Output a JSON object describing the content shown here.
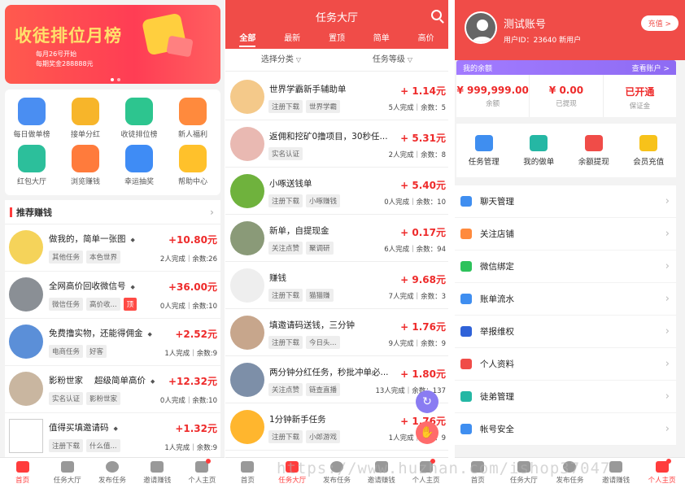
{
  "panel1": {
    "banner": {
      "title": "收徒排位月榜",
      "line1": "每月26号开始",
      "line2": "每期奖金288888元"
    },
    "icons": [
      {
        "label": "每日做单榜",
        "icon": "list-icon",
        "color": "#4a8ef2"
      },
      {
        "label": "接单分红",
        "icon": "yen-icon",
        "color": "#f7b52a"
      },
      {
        "label": "收徒排位榜",
        "icon": "bar-chart-icon",
        "color": "#2dc58f"
      },
      {
        "label": "新人福利",
        "icon": "gift-icon",
        "color": "#ff8a3d"
      },
      {
        "label": "红包大厅",
        "icon": "red-envelope-icon",
        "color": "#2cbf9b"
      },
      {
        "label": "浏览赚钱",
        "icon": "money-bag-icon",
        "color": "#ff7b3c"
      },
      {
        "label": "幸运抽奖",
        "icon": "wheel-icon",
        "color": "#3f8cf5"
      },
      {
        "label": "帮助中心",
        "icon": "bulb-icon",
        "color": "#ffc12b"
      }
    ],
    "recommend_title": "推荐赚钱",
    "items": [
      {
        "title": "做我的，简单一张图",
        "platforms": " ",
        "price": "+10.80元",
        "tags": [
          "其他任务",
          "本色世界"
        ],
        "stat": "2人完成｜余数:26",
        "color": "#f5d35a"
      },
      {
        "title": "全网高价回收微信号",
        "platforms": " ",
        "price": "+36.00元",
        "tags": [
          "微信任务",
          "高价收...",
          "顶"
        ],
        "stat": "0人完成｜余数:10",
        "color": "#8a8f95"
      },
      {
        "title": "免费撸实物，还能得佣金",
        "platforms": " ",
        "price": "+2.52元",
        "tags": [
          "电商任务",
          "好客"
        ],
        "stat": "1人完成｜余数:9",
        "color": "#5b8fd8"
      },
      {
        "title": "影粉世家",
        "platforms": " ",
        "price": "+12.32元",
        "tags": [
          "实名认证",
          "影粉世家"
        ],
        "stat": "0人完成｜余数:10",
        "color": "#c9b6a0"
      },
      {
        "title": "值得买填邀请码",
        "platforms": " ",
        "price": "+1.32元",
        "tags": [
          "注册下载",
          "什么值..."
        ],
        "stat": "1人完成｜余数:9",
        "color": "#ffffff"
      }
    ],
    "item4_extra": "超级简单高价",
    "tabs": [
      {
        "label": "首页",
        "icon": "home-icon",
        "active": true
      },
      {
        "label": "任务大厅",
        "icon": "clipboard-icon",
        "active": false
      },
      {
        "label": "发布任务",
        "icon": "plus-icon",
        "active": false
      },
      {
        "label": "邀请赚钱",
        "icon": "users-icon",
        "active": false
      },
      {
        "label": "个人主页",
        "icon": "person-icon",
        "active": false
      }
    ]
  },
  "panel2": {
    "title": "任务大厅",
    "tabs": [
      "全部",
      "最新",
      "置顶",
      "简单",
      "高价"
    ],
    "filters": [
      "选择分类",
      "任务等级"
    ],
    "items": [
      {
        "title": "世界学霸新手辅助单",
        "price": "+ 1.14元",
        "tags": [
          "注册下载",
          "世界学霸"
        ],
        "stat": "5人完成｜余数：5",
        "color": "#f4c98a"
      },
      {
        "title": "返佣和挖矿0撸项目，30秒任...",
        "price": "+ 5.31元",
        "tags": [
          "实名认证"
        ],
        "stat": "2人完成｜余数：8",
        "color": "#e9b9b2"
      },
      {
        "title": "小啄送钱单",
        "price": "+ 5.40元",
        "tags": [
          "注册下载",
          "小啄赚钱"
        ],
        "stat": "0人完成｜余数：10",
        "color": "#6fb23d"
      },
      {
        "title": "新单，自提现金",
        "price": "+ 0.17元",
        "tags": [
          "关注点赞",
          "聚调研"
        ],
        "stat": "6人完成｜余数：94",
        "color": "#8a9a78"
      },
      {
        "title": "赚钱",
        "price": "+ 9.68元",
        "tags": [
          "注册下载",
          "猫猫赚"
        ],
        "stat": "7人完成｜余数：3",
        "color": "#eeeeee"
      },
      {
        "title": "填邀请码送钱，三分钟",
        "price": "+ 1.76元",
        "tags": [
          "注册下载",
          "今日头..."
        ],
        "stat": "9人完成｜余数：9",
        "color": "#c7a68c"
      },
      {
        "title": "两分钟分红任务，秒批冲单必...",
        "price": "+ 1.80元",
        "tags": [
          "关注点赞",
          "链查直播"
        ],
        "stat": "13人完成｜余数：137",
        "color": "#7d8fa8"
      },
      {
        "title": "1分钟新手任务",
        "price": "+ 1.76元",
        "tags": [
          "注册下载",
          "小郎游戏"
        ],
        "stat": "1人完成｜余数：9",
        "color": "#ffb62e"
      }
    ],
    "tabs_bottom": [
      {
        "label": "首页",
        "active": false
      },
      {
        "label": "任务大厅",
        "active": true
      },
      {
        "label": "发布任务",
        "active": false
      },
      {
        "label": "邀请赚钱",
        "active": false
      },
      {
        "label": "个人主页",
        "active": false
      }
    ]
  },
  "panel3": {
    "name": "测试账号",
    "uid": "用户ID：23640 新用户",
    "recharge": "充值 >",
    "balance_title": "我的余额",
    "view_account": "查看账户 >",
    "balances": [
      {
        "value": "¥ 999,999.00",
        "label": "余额"
      },
      {
        "value": "¥ 0.00",
        "label": "已提现"
      },
      {
        "value": "已开通",
        "label": "保证金"
      }
    ],
    "quick": [
      {
        "label": "任务管理",
        "icon": "task-icon",
        "color": "#3f8ef0"
      },
      {
        "label": "我的做单",
        "icon": "card-icon",
        "color": "#25b7a4"
      },
      {
        "label": "余额提现",
        "icon": "wallet-icon",
        "color": "#f04c48"
      },
      {
        "label": "会员充值",
        "icon": "crown-icon",
        "color": "#f7c21a"
      }
    ],
    "menu": [
      {
        "label": "聊天管理",
        "icon": "chat-icon",
        "color": "#3f8ef0"
      },
      {
        "label": "关注店铺",
        "icon": "shop-icon",
        "color": "#ff8a3d"
      },
      {
        "label": "微信绑定",
        "icon": "wechat-icon",
        "color": "#2dc25b"
      },
      {
        "label": "账单流水",
        "icon": "bill-icon",
        "color": "#3f8ef0"
      },
      {
        "label": "举报维权",
        "icon": "warning-icon",
        "color": "#2f62d8"
      },
      {
        "label": "个人资料",
        "icon": "profile-icon",
        "color": "#f04c48"
      },
      {
        "label": "徒弟管理",
        "icon": "apprentice-icon",
        "color": "#25b7a4"
      },
      {
        "label": "帐号安全",
        "icon": "shield-icon",
        "color": "#3f8ef0"
      }
    ],
    "tabs_bottom": [
      {
        "label": "首页",
        "active": false
      },
      {
        "label": "任务大厅",
        "active": false
      },
      {
        "label": "发布任务",
        "active": false
      },
      {
        "label": "邀请赚钱",
        "active": false
      },
      {
        "label": "个人主页",
        "active": true
      }
    ]
  },
  "watermark": "https://www.huzhan.com/ishop37047"
}
